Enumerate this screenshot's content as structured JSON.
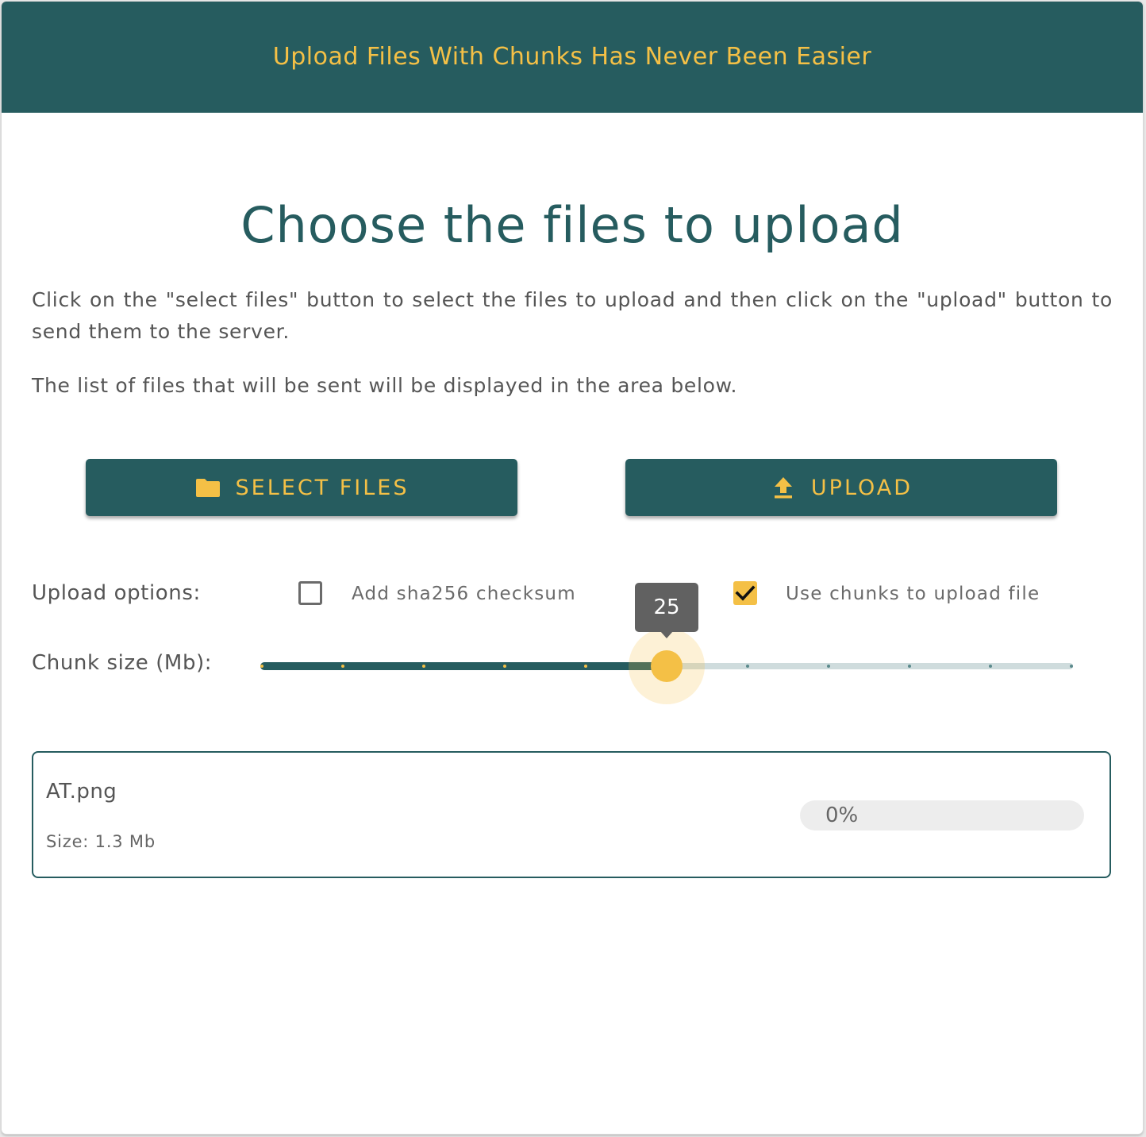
{
  "header": {
    "title": "Upload Files With Chunks Has Never Been Easier"
  },
  "main": {
    "title": "Choose the files to upload",
    "instructions": "Click on the \"select files\" button to select the files to upload and then click on the \"upload\" button to send them to the server.",
    "list_note": "The list of files that will be sent will be displayed in the area below."
  },
  "buttons": {
    "select_files": {
      "label": "SELECT FILES",
      "icon": "folder-icon"
    },
    "upload": {
      "label": "UPLOAD",
      "icon": "upload-icon"
    }
  },
  "options": {
    "label": "Upload options:",
    "sha256": {
      "label": "Add sha256 checksum",
      "checked": false
    },
    "chunks": {
      "label": "Use chunks to upload file",
      "checked": true
    }
  },
  "chunk_size": {
    "label": "Chunk size (Mb):",
    "value": "25",
    "position_fraction": 0.5,
    "step_count": 10
  },
  "files": [
    {
      "name": "AT.png",
      "size": "Size: 1.3 Mb",
      "progress_text": "0%",
      "progress": 0
    }
  ],
  "colors": {
    "primary": "#265c5f",
    "accent": "#f4c046",
    "text": "#555555"
  }
}
